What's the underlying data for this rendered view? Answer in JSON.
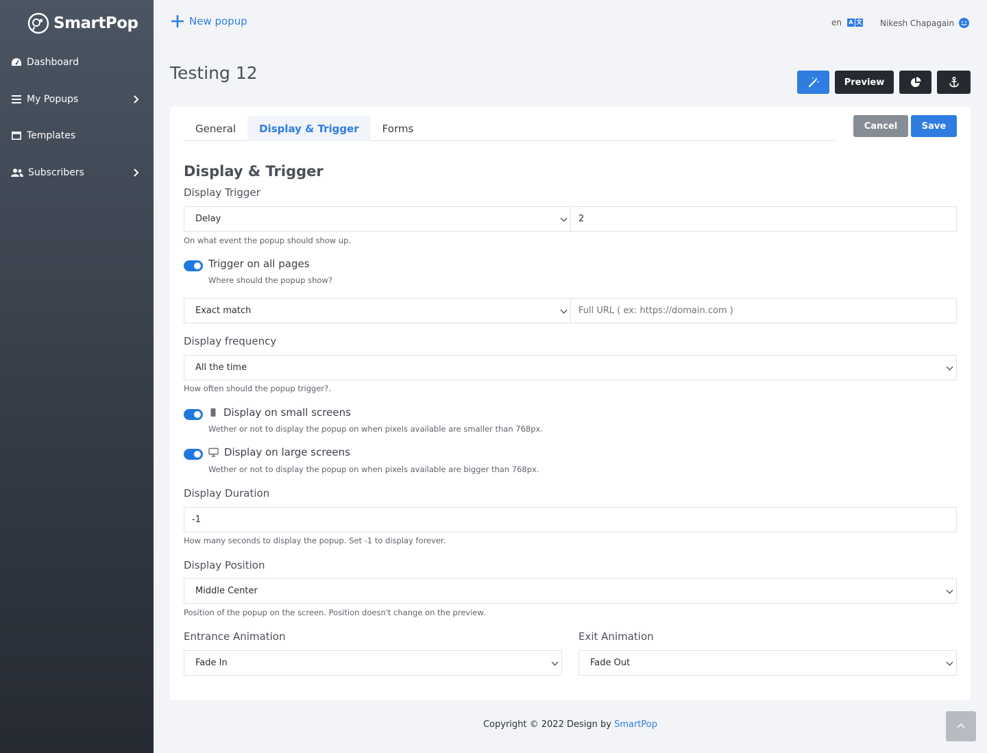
{
  "brand": {
    "name": "SmartPop",
    "accent": "#2f7de1"
  },
  "sidebar": {
    "items": [
      {
        "label": "Dashboard",
        "icon": "dashboard-icon",
        "has_submenu": false
      },
      {
        "label": "My Popups",
        "icon": "list-icon",
        "has_submenu": true
      },
      {
        "label": "Templates",
        "icon": "template-icon",
        "has_submenu": false
      },
      {
        "label": "Subscribers",
        "icon": "users-icon",
        "has_submenu": true
      }
    ]
  },
  "topbar": {
    "new_popup_label": "New popup",
    "language": "en",
    "user_name": "Nikesh Chapagain"
  },
  "page": {
    "title": "Testing 12",
    "actions": {
      "preview_label": "Preview"
    }
  },
  "tabs": [
    {
      "label": "General",
      "active": false
    },
    {
      "label": "Display & Trigger",
      "active": true
    },
    {
      "label": "Forms",
      "active": false
    }
  ],
  "card_actions": {
    "cancel_label": "Cancel",
    "save_label": "Save"
  },
  "form": {
    "section_title": "Display & Trigger",
    "display_trigger": {
      "label": "Display Trigger",
      "selected": "Delay",
      "value": "2",
      "help": "On what event the popup should show up."
    },
    "trigger_all_pages": {
      "label": "Trigger on all pages",
      "enabled": true,
      "help": "Where should the popup show?"
    },
    "url_match": {
      "selected": "Exact match",
      "placeholder": "Full URL ( ex: https://domain.com )"
    },
    "display_frequency": {
      "label": "Display frequency",
      "selected": "All the time",
      "help": "How often should the popup trigger?."
    },
    "small_screens": {
      "label": "Display on small screens",
      "enabled": true,
      "help": "Wether or not to display the popup on when pixels available are smaller than 768px."
    },
    "large_screens": {
      "label": "Display on large screens",
      "enabled": true,
      "help": "Wether or not to display the popup on when pixels available are bigger than 768px."
    },
    "display_duration": {
      "label": "Display Duration",
      "value": "-1",
      "help": "How many seconds to display the popup. Set -1 to display forever."
    },
    "display_position": {
      "label": "Display Position",
      "selected": "Middle Center",
      "help": "Position of the popup on the screen. Position doesn't change on the preview."
    },
    "entrance_animation": {
      "label": "Entrance Animation",
      "selected": "Fade In"
    },
    "exit_animation": {
      "label": "Exit Animation",
      "selected": "Fade Out"
    }
  },
  "footer": {
    "text": "Copyright © 2022 Design by",
    "link_label": "SmartPop"
  }
}
